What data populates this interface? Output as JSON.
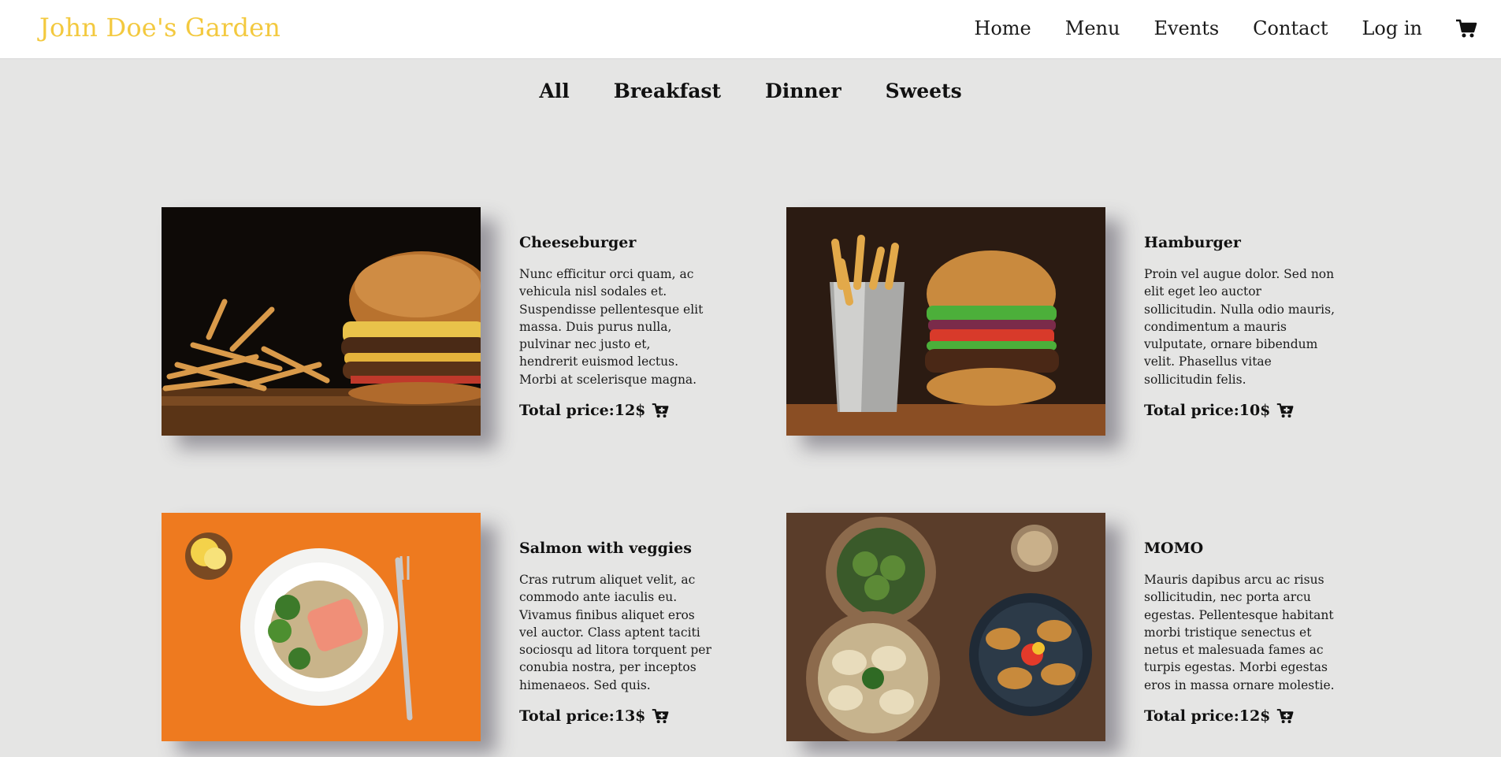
{
  "brand": "John Doe's Garden",
  "nav": {
    "items": [
      "Home",
      "Menu",
      "Events",
      "Contact",
      "Log in"
    ],
    "cart_icon": "cart-icon"
  },
  "filters": [
    "All",
    "Breakfast",
    "Dinner",
    "Sweets"
  ],
  "colors": {
    "brand": "#f3c93f",
    "page_background": "#e5e5e4",
    "navbar_background": "#ffffff",
    "text": "#111111"
  },
  "menu_items": [
    {
      "name": "Cheeseburger",
      "description": "Nunc efficitur orci quam, ac vehicula nisl sodales et. Suspendisse pellentesque elit massa. Duis purus nulla, pulvinar nec justo et, hendrerit euismod lectus. Morbi at scelerisque magna.",
      "price": "Total price:12$",
      "image": "cheeseburger-photo"
    },
    {
      "name": "Hamburger",
      "description": "Proin vel augue dolor. Sed non elit eget leo auctor sollicitudin. Nulla odio mauris, condimentum a mauris vulputate, ornare bibendum velit. Phasellus vitae sollicitudin felis.",
      "price": "Total price:10$",
      "image": "hamburger-photo"
    },
    {
      "name": "Salmon with veggies",
      "description": "Cras rutrum aliquet velit, ac commodo ante iaculis eu. Vivamus finibus aliquet eros vel auctor. Class aptent taciti sociosqu ad litora torquent per conubia nostra, per inceptos himenaeos. Sed quis.",
      "price": "Total price:13$",
      "image": "salmon-photo"
    },
    {
      "name": "MOMO",
      "description": "Mauris dapibus arcu ac risus sollicitudin, nec porta arcu egestas. Pellentesque habitant morbi tristique senectus et netus et malesuada fames ac turpis egestas. Morbi egestas eros in massa ornare molestie.",
      "price": "Total price:12$",
      "image": "momo-photo"
    }
  ]
}
